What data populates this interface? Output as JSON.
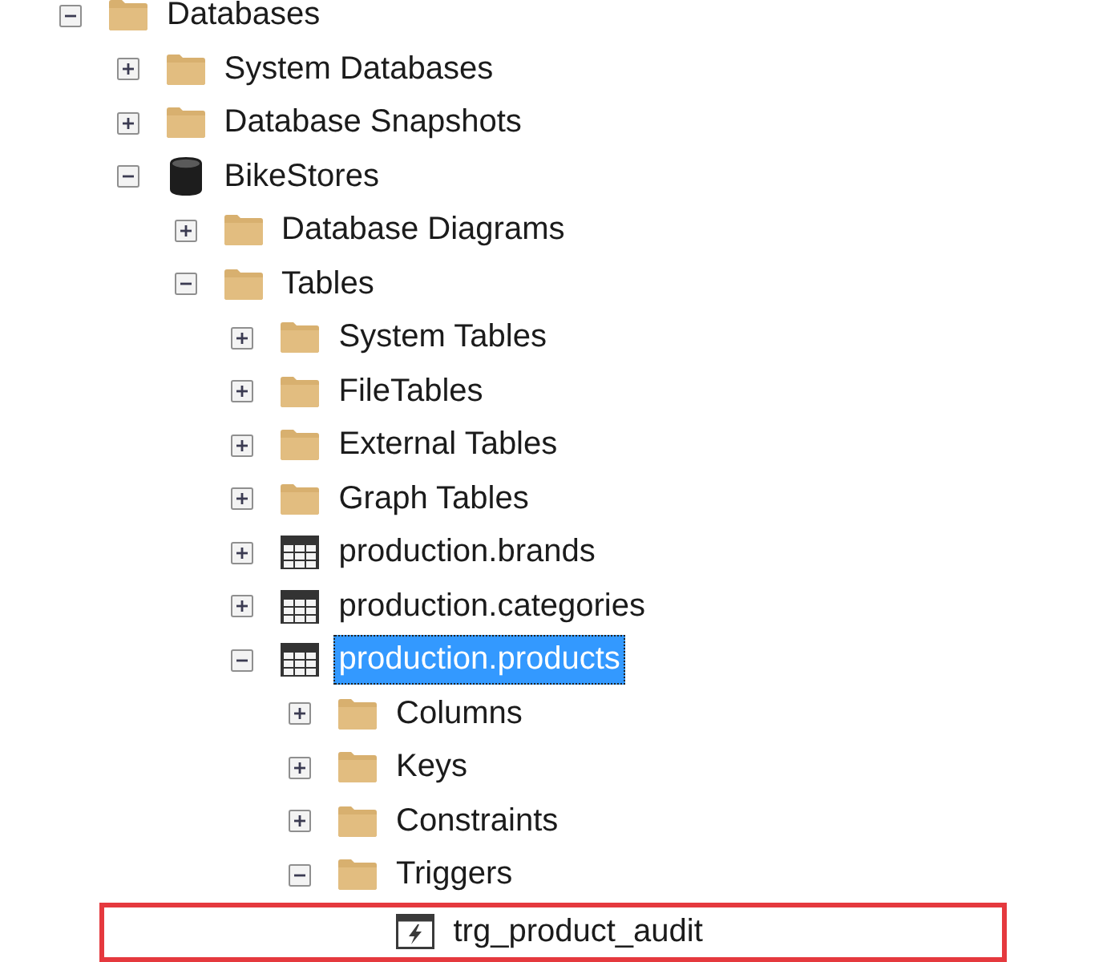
{
  "tree": [
    {
      "label": "Databases",
      "kind": "folder",
      "expanded": true,
      "selected": false,
      "children": [
        {
          "label": "System Databases",
          "kind": "folder",
          "expanded": false,
          "selected": false
        },
        {
          "label": "Database Snapshots",
          "kind": "folder",
          "expanded": false,
          "selected": false
        },
        {
          "label": "BikeStores",
          "kind": "database",
          "expanded": true,
          "selected": false,
          "children": [
            {
              "label": "Database Diagrams",
              "kind": "folder",
              "expanded": false,
              "selected": false
            },
            {
              "label": "Tables",
              "kind": "folder",
              "expanded": true,
              "selected": false,
              "children": [
                {
                  "label": "System Tables",
                  "kind": "folder",
                  "expanded": false,
                  "selected": false
                },
                {
                  "label": "FileTables",
                  "kind": "folder",
                  "expanded": false,
                  "selected": false
                },
                {
                  "label": "External Tables",
                  "kind": "folder",
                  "expanded": false,
                  "selected": false
                },
                {
                  "label": "Graph Tables",
                  "kind": "folder",
                  "expanded": false,
                  "selected": false
                },
                {
                  "label": "production.brands",
                  "kind": "table",
                  "expanded": false,
                  "selected": false
                },
                {
                  "label": "production.categories",
                  "kind": "table",
                  "expanded": false,
                  "selected": false
                },
                {
                  "label": "production.products",
                  "kind": "table",
                  "expanded": true,
                  "selected": true,
                  "children": [
                    {
                      "label": "Columns",
                      "kind": "folder",
                      "expanded": false,
                      "selected": false
                    },
                    {
                      "label": "Keys",
                      "kind": "folder",
                      "expanded": false,
                      "selected": false
                    },
                    {
                      "label": "Constraints",
                      "kind": "folder",
                      "expanded": false,
                      "selected": false
                    },
                    {
                      "label": "Triggers",
                      "kind": "folder",
                      "expanded": true,
                      "selected": false,
                      "children": [
                        {
                          "label": "trg_product_audit",
                          "kind": "trigger",
                          "selected": false,
                          "highlighted": true
                        }
                      ]
                    }
                  ]
                }
              ]
            }
          ]
        }
      ]
    }
  ]
}
